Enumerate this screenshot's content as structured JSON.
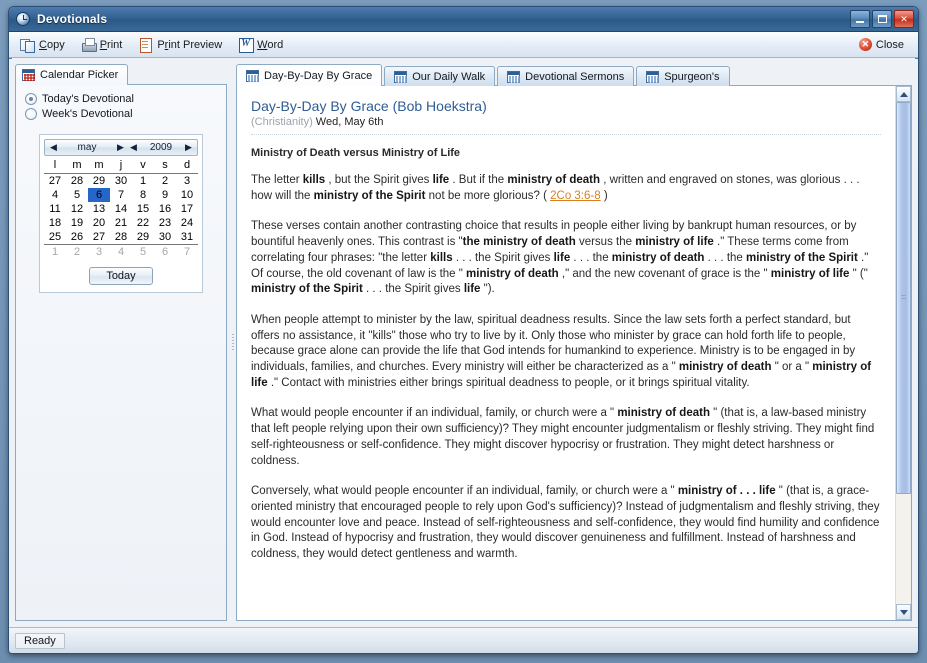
{
  "window": {
    "title": "Devotionals",
    "icon": "clock-icon",
    "buttons": {
      "minimize": "_",
      "maximize": "□",
      "close": "✕"
    }
  },
  "toolbar": {
    "items": [
      {
        "label": "Copy",
        "accel": "C",
        "icon": "copy-icon"
      },
      {
        "label": "Print",
        "accel": "P",
        "icon": "printer-icon"
      },
      {
        "label": "Print Preview",
        "accel": "r",
        "icon": "print-preview-icon"
      },
      {
        "label": "Word",
        "accel": "W",
        "icon": "word-icon"
      }
    ],
    "close": {
      "label": "Close",
      "icon": "close-circle-icon"
    }
  },
  "left_pane": {
    "tab": {
      "label": "Calendar Picker",
      "icon": "calendar-icon"
    },
    "radios": [
      {
        "label": "Today's Devotional",
        "selected": true
      },
      {
        "label": "Week's Devotional",
        "selected": false
      }
    ],
    "calendar": {
      "month": "may",
      "year": "2009",
      "prev_month_arrow": "◀",
      "next_month_arrow": "▶",
      "prev_year_arrow": "◀",
      "next_year_arrow": "▶",
      "day_headers": [
        "l",
        "m",
        "m",
        "j",
        "v",
        "s",
        "d"
      ],
      "selected_day": 6,
      "weeks": [
        [
          {
            "d": "27",
            "t": "out"
          },
          {
            "d": "28",
            "t": "out"
          },
          {
            "d": "29",
            "t": "out"
          },
          {
            "d": "30",
            "t": "out"
          },
          {
            "d": "1",
            "t": "in"
          },
          {
            "d": "2",
            "t": "we"
          },
          {
            "d": "3",
            "t": "we"
          }
        ],
        [
          {
            "d": "4",
            "t": "in"
          },
          {
            "d": "5",
            "t": "in"
          },
          {
            "d": "6",
            "t": "sel"
          },
          {
            "d": "7",
            "t": "in"
          },
          {
            "d": "8",
            "t": "in"
          },
          {
            "d": "9",
            "t": "we"
          },
          {
            "d": "10",
            "t": "we"
          }
        ],
        [
          {
            "d": "11",
            "t": "in"
          },
          {
            "d": "12",
            "t": "in"
          },
          {
            "d": "13",
            "t": "in"
          },
          {
            "d": "14",
            "t": "in"
          },
          {
            "d": "15",
            "t": "in"
          },
          {
            "d": "16",
            "t": "we"
          },
          {
            "d": "17",
            "t": "we"
          }
        ],
        [
          {
            "d": "18",
            "t": "in"
          },
          {
            "d": "19",
            "t": "in"
          },
          {
            "d": "20",
            "t": "in"
          },
          {
            "d": "21",
            "t": "in"
          },
          {
            "d": "22",
            "t": "in"
          },
          {
            "d": "23",
            "t": "we"
          },
          {
            "d": "24",
            "t": "we"
          }
        ],
        [
          {
            "d": "25",
            "t": "in"
          },
          {
            "d": "26",
            "t": "in"
          },
          {
            "d": "27",
            "t": "in"
          },
          {
            "d": "28",
            "t": "in"
          },
          {
            "d": "29",
            "t": "in"
          },
          {
            "d": "30",
            "t": "we"
          },
          {
            "d": "31",
            "t": "we"
          }
        ],
        [
          {
            "d": "1",
            "t": "out"
          },
          {
            "d": "2",
            "t": "out"
          },
          {
            "d": "3",
            "t": "out"
          },
          {
            "d": "4",
            "t": "out"
          },
          {
            "d": "5",
            "t": "out"
          },
          {
            "d": "6",
            "t": "out"
          },
          {
            "d": "7",
            "t": "out"
          }
        ]
      ],
      "today_button": "Today"
    }
  },
  "tabs": [
    {
      "label": "Day-By-Day By Grace",
      "active": true,
      "icon": "calendar-icon"
    },
    {
      "label": "Our Daily Walk",
      "active": false,
      "icon": "calendar-icon"
    },
    {
      "label": "Devotional Sermons",
      "active": false,
      "icon": "calendar-icon"
    },
    {
      "label": "Spurgeon's",
      "active": false,
      "icon": "calendar-icon"
    }
  ],
  "document": {
    "title": "Day-By-Day By Grace (Bob Hoekstra)",
    "category": "(Christianity)",
    "date": "Wed, May 6th",
    "heading": "Ministry of Death versus Ministry of Life",
    "scripture_ref": "2Co 3:6-8",
    "paragraphs": [
      {
        "runs": [
          {
            "t": "The letter ",
            "b": false
          },
          {
            "t": "kills",
            "b": true
          },
          {
            "t": " , but the Spirit gives ",
            "b": false
          },
          {
            "t": "life",
            "b": true
          },
          {
            "t": " . But if the ",
            "b": false
          },
          {
            "t": "ministry of death",
            "b": true
          },
          {
            "t": " , written and engraved on stones, was glorious . . . how will the ",
            "b": false
          },
          {
            "t": "ministry of the Spirit",
            "b": true
          },
          {
            "t": " not be more glorious? ( ",
            "b": false
          },
          {
            "t": "2Co 3:6-8",
            "b": false,
            "ref": true
          },
          {
            "t": " )",
            "b": false
          }
        ]
      },
      {
        "runs": [
          {
            "t": "These verses contain another contrasting choice that results in people either living by bankrupt human resources, or by bountiful heavenly ones. This contrast is \"",
            "b": false
          },
          {
            "t": "the ministry of death",
            "b": true
          },
          {
            "t": " versus the ",
            "b": false
          },
          {
            "t": "ministry of life",
            "b": true
          },
          {
            "t": " .\" These terms come from correlating four phrases: \"the letter ",
            "b": false
          },
          {
            "t": "kills",
            "b": true
          },
          {
            "t": " . . . the Spirit gives ",
            "b": false
          },
          {
            "t": "life",
            "b": true
          },
          {
            "t": " . . . the ",
            "b": false
          },
          {
            "t": "ministry of death",
            "b": true
          },
          {
            "t": " . . . the ",
            "b": false
          },
          {
            "t": "ministry of the Spirit",
            "b": true
          },
          {
            "t": " .\" Of course, the old covenant of law is the \" ",
            "b": false
          },
          {
            "t": "ministry of death",
            "b": true
          },
          {
            "t": " ,\" and the new covenant of grace is the \" ",
            "b": false
          },
          {
            "t": "ministry of life",
            "b": true
          },
          {
            "t": " \" (\" ",
            "b": false
          },
          {
            "t": "ministry of the Spirit",
            "b": true
          },
          {
            "t": " . . . the Spirit gives ",
            "b": false
          },
          {
            "t": "life",
            "b": true
          },
          {
            "t": " \").",
            "b": false
          }
        ]
      },
      {
        "runs": [
          {
            "t": "When people attempt to minister by the law, spiritual deadness results. Since the law sets forth a perfect standard, but offers no assistance, it \"kills\" those who try to live by it. Only those who minister by grace can hold forth life to people, because grace alone can provide the life that God intends for humankind to experience. Ministry is to be engaged in by individuals, families, and churches. Every ministry will either be characterized as a \" ",
            "b": false
          },
          {
            "t": "ministry of death",
            "b": true
          },
          {
            "t": " \" or a \" ",
            "b": false
          },
          {
            "t": "ministry of life",
            "b": true
          },
          {
            "t": " .\" Contact with ministries either brings spiritual deadness to people, or it brings spiritual vitality.",
            "b": false
          }
        ]
      },
      {
        "runs": [
          {
            "t": "What would people encounter if an individual, family, or church were a \" ",
            "b": false
          },
          {
            "t": "ministry of death",
            "b": true
          },
          {
            "t": " \" (that is, a law-based ministry that left people relying upon their own sufficiency)? They might encounter judgmentalism or fleshly striving. They might find self-righteousness or self-confidence. They might discover hypocrisy or frustration. They might detect harshness or coldness.",
            "b": false
          }
        ]
      },
      {
        "runs": [
          {
            "t": "Conversely, what would people encounter if an individual, family, or church were a \" ",
            "b": false
          },
          {
            "t": "ministry of . . . life",
            "b": true
          },
          {
            "t": " \" (that is, a grace-oriented ministry that encouraged people to rely upon God's sufficiency)? Instead of judgmentalism and fleshly striving, they would encounter love and peace. Instead of self-righteousness and self-confidence, they would find humility and confidence in God. Instead of hypocrisy and frustration, they would discover genuineness and fulfillment. Instead of harshness and coldness, they would detect gentleness and warmth.",
            "b": false
          }
        ]
      }
    ]
  },
  "scrollbar": {
    "up_arrow": "▲",
    "down_arrow": "▼",
    "thumb_percent": 78
  },
  "status_bar": {
    "text": "Ready"
  },
  "colors": {
    "title_blue": "#32618f",
    "doc_title_blue": "#2f5d96",
    "ref_orange": "#d97f1e",
    "weekend_red": "#e02020",
    "selected_day_blue": "#2566c8",
    "close_red": "#d9462b"
  }
}
